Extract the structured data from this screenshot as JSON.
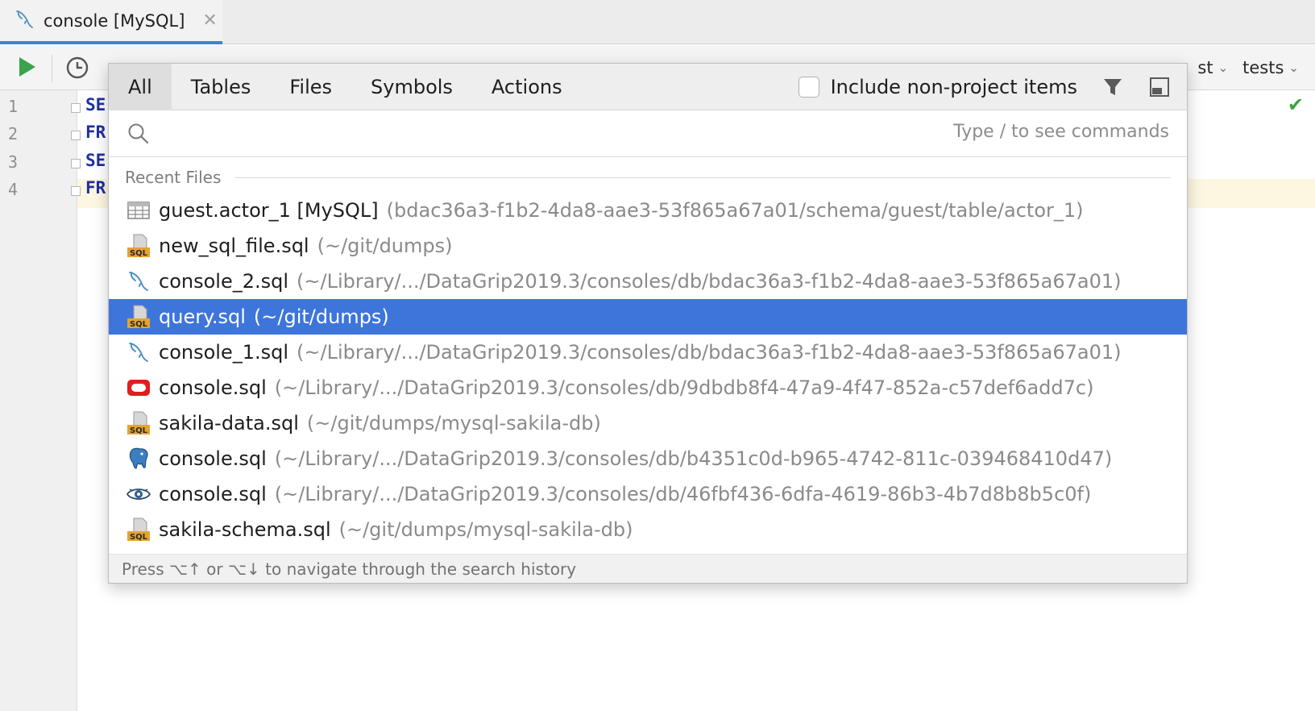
{
  "editor_tab": {
    "label": "console [MySQL]",
    "icon": "mysql-dolphin-icon",
    "close_glyph": "✕"
  },
  "toolbar": {
    "run_icon": "play-icon",
    "history_icon": "clock-icon",
    "right_fragment": "st",
    "schema_label": "tests"
  },
  "editor": {
    "line_numbers": [
      "1",
      "2",
      "3",
      "4"
    ],
    "code_fragments": [
      "SE",
      "FR",
      "SE",
      "FR"
    ],
    "status_icon": "checkmark-icon",
    "status_glyph": "✔"
  },
  "popup": {
    "tabs": [
      {
        "label": "All",
        "active": true
      },
      {
        "label": "Tables",
        "active": false
      },
      {
        "label": "Files",
        "active": false
      },
      {
        "label": "Symbols",
        "active": false
      },
      {
        "label": "Actions",
        "active": false
      }
    ],
    "include_non_project_label": "Include non-project items",
    "include_non_project_checked": false,
    "filter_icon": "filter-icon",
    "pin_icon": "pin-window-icon",
    "search": {
      "value": "",
      "hint": "Type / to see commands",
      "icon": "search-icon"
    },
    "section_title": "Recent Files",
    "results": [
      {
        "icon": "table-icon",
        "name": "guest.actor_1 [MySQL]",
        "path": "(bdac36a3-f1b2-4da8-aae3-53f865a67a01/schema/guest/table/actor_1)",
        "selected": false
      },
      {
        "icon": "sql-file-icon",
        "name": "new_sql_file.sql",
        "path": "(~/git/dumps)",
        "selected": false
      },
      {
        "icon": "mysql-dolphin-icon",
        "name": "console_2.sql",
        "path": "(~/Library/.../DataGrip2019.3/consoles/db/bdac36a3-f1b2-4da8-aae3-53f865a67a01)",
        "selected": false
      },
      {
        "icon": "sql-file-icon",
        "name": "query.sql",
        "path": "(~/git/dumps)",
        "selected": true
      },
      {
        "icon": "mysql-dolphin-icon",
        "name": "console_1.sql",
        "path": "(~/Library/.../DataGrip2019.3/consoles/db/bdac36a3-f1b2-4da8-aae3-53f865a67a01)",
        "selected": false
      },
      {
        "icon": "oracle-icon",
        "name": "console.sql",
        "path": "(~/Library/.../DataGrip2019.3/consoles/db/9dbdb8f4-47a9-4f47-852a-c57def6add7c)",
        "selected": false
      },
      {
        "icon": "sql-file-icon",
        "name": "sakila-data.sql",
        "path": "(~/git/dumps/mysql-sakila-db)",
        "selected": false
      },
      {
        "icon": "postgresql-elephant-icon",
        "name": "console.sql",
        "path": "(~/Library/.../DataGrip2019.3/consoles/db/b4351c0d-b965-4742-811c-039468410d47)",
        "selected": false
      },
      {
        "icon": "eye-icon",
        "name": "console.sql",
        "path": "(~/Library/.../DataGrip2019.3/consoles/db/46fbf436-6dfa-4619-86b3-4b7d8b8b5c0f)",
        "selected": false
      },
      {
        "icon": "sql-file-icon",
        "name": "sakila-schema.sql",
        "path": "(~/git/dumps/mysql-sakila-db)",
        "selected": false
      }
    ],
    "footer": "Press ⌥↑ or ⌥↓ to navigate through the search history"
  },
  "colors": {
    "selection": "#3d75db",
    "tab_underline": "#4083c9",
    "run_green": "#3aa34b",
    "keyword_blue": "#1f2fa2",
    "sql_badge": "#e5a42d",
    "oracle_red": "#e21d1d",
    "postgres_blue": "#3c7fc0"
  }
}
